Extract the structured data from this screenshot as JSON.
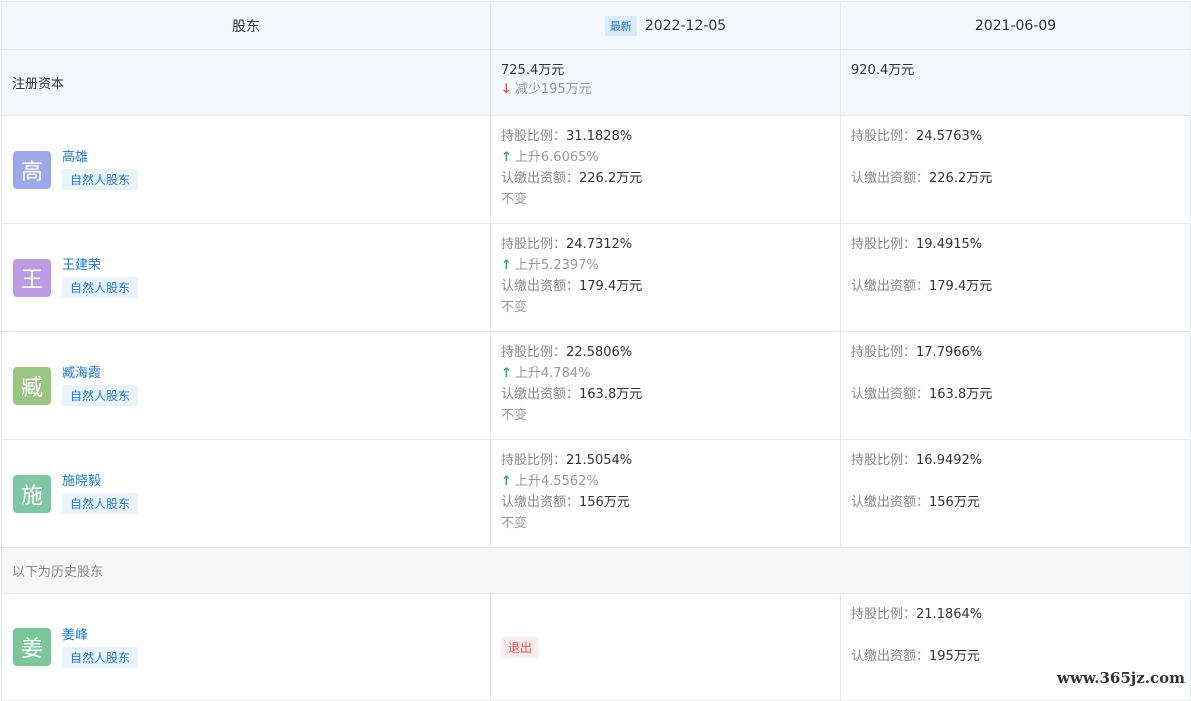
{
  "header": {
    "col1": "股东",
    "latest_badge": "最新",
    "date1": "2022-12-05",
    "date2": "2021-06-09"
  },
  "capital": {
    "label": "注册资本",
    "v1": "725.4万元",
    "v1_change": "减少195万元",
    "v2": "920.4万元"
  },
  "labels": {
    "ratio": "持股比例：",
    "subscribed": "认缴出资额：",
    "unchanged": "不变",
    "person_tag": "自然人股东"
  },
  "shareholders": [
    {
      "avatar": "高",
      "name": "高雄",
      "r1": "31.1828%",
      "r1_change": "上升6.6065%",
      "s1": "226.2万元",
      "r2": "24.5763%",
      "s2": "226.2万元"
    },
    {
      "avatar": "王",
      "name": "王建荣",
      "r1": "24.7312%",
      "r1_change": "上升5.2397%",
      "s1": "179.4万元",
      "r2": "19.4915%",
      "s2": "179.4万元"
    },
    {
      "avatar": "臧",
      "name": "臧海霞",
      "r1": "22.5806%",
      "r1_change": "上升4.784%",
      "s1": "163.8万元",
      "r2": "17.7966%",
      "s2": "163.8万元"
    },
    {
      "avatar": "施",
      "name": "施晓毅",
      "r1": "21.5054%",
      "r1_change": "上升4.5562%",
      "s1": "156万元",
      "r2": "16.9492%",
      "s2": "156万元"
    }
  ],
  "history": {
    "label": "以下为历史股东",
    "avatar": "姜",
    "name": "姜峰",
    "exit": "退出",
    "r2": "21.1864%",
    "s2": "195万元"
  },
  "watermark": "www.365jz.com",
  "colors": {
    "link": "#1f7ad6",
    "up": "#2ea776",
    "down": "#e35b5b",
    "header_bg": "#f2f8fd"
  }
}
